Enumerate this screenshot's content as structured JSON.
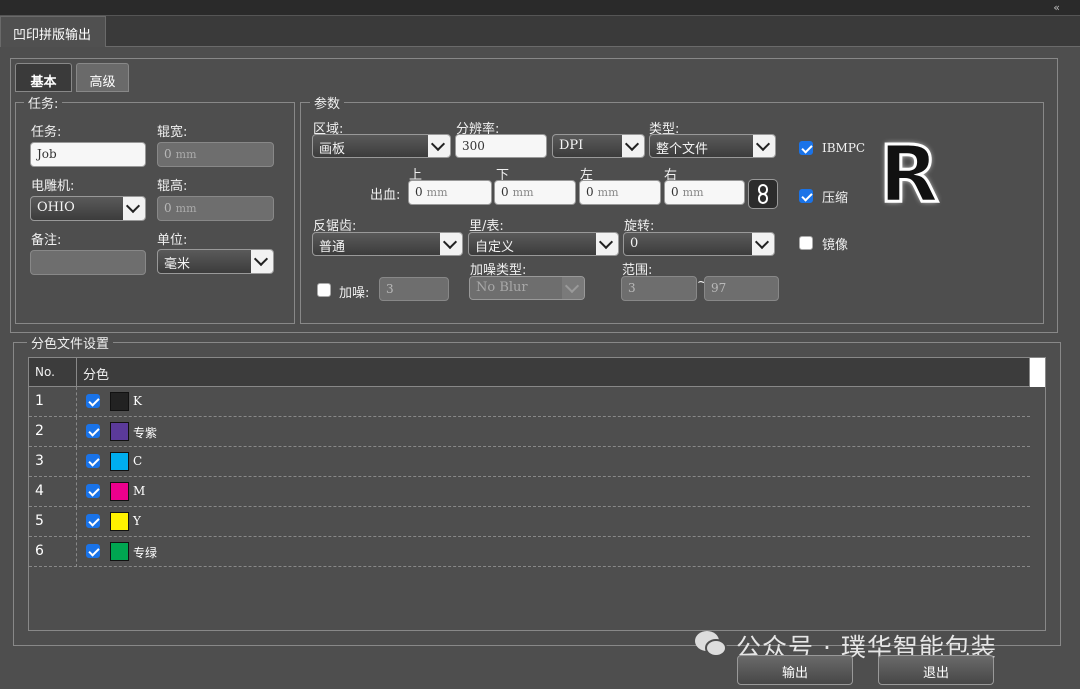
{
  "window": {
    "tab_title": "凹印拼版输出",
    "collapse_glyph": "«"
  },
  "tabs": {
    "basic": "基本",
    "advanced": "高级"
  },
  "task": {
    "group_title": "任务:",
    "task_label": "任务:",
    "task_value": "Job",
    "roll_width_label": "辊宽:",
    "roll_width_value": "0",
    "roll_width_unit": "mm",
    "engraver_label": "电雕机:",
    "engraver_value": "OHIO",
    "roll_height_label": "辊高:",
    "roll_height_value": "0",
    "roll_height_unit": "mm",
    "note_label": "备注:",
    "note_value": "",
    "unit_label": "单位:",
    "unit_value": "毫米"
  },
  "params": {
    "group_title": "参数",
    "region_label": "区域:",
    "region_value": "画板",
    "resolution_label": "分辨率:",
    "resolution_value": "300",
    "resolution_unit": "DPI",
    "type_label": "类型:",
    "type_value": "整个文件",
    "bleed_label": "出血:",
    "bleed_top_label": "上",
    "bleed_top_value": "0",
    "bleed_bottom_label": "下",
    "bleed_bottom_value": "0",
    "bleed_left_label": "左",
    "bleed_left_value": "0",
    "bleed_right_label": "右",
    "bleed_right_value": "0",
    "bleed_unit": "mm",
    "antialias_label": "反锯齿:",
    "antialias_value": "普通",
    "side_label": "里/表:",
    "side_value": "自定义",
    "rotate_label": "旋转:",
    "rotate_value": "0",
    "noise_label": "加噪:",
    "noise_value": "3",
    "noise_checked": false,
    "noise_type_label": "加噪类型:",
    "noise_type_value": "No Blur",
    "range_label": "范围:",
    "range_min": "3",
    "range_sep": "~",
    "range_max": "97",
    "ibmpc_label": "IBMPC",
    "ibmpc_checked": true,
    "compress_label": "压缩",
    "compress_checked": true,
    "mirror_label": "镜像",
    "mirror_checked": false,
    "logo_letter": "R"
  },
  "separations": {
    "group_title": "分色文件设置",
    "col_no": "No.",
    "col_sep": "分色",
    "rows": [
      {
        "no": "1",
        "name": "K",
        "color": "#222222",
        "checked": true
      },
      {
        "no": "2",
        "name": "专紫",
        "color": "#5b3a9a",
        "checked": true
      },
      {
        "no": "3",
        "name": "C",
        "color": "#00aeef",
        "checked": true
      },
      {
        "no": "4",
        "name": "M",
        "color": "#ec008c",
        "checked": true
      },
      {
        "no": "5",
        "name": "Y",
        "color": "#fff200",
        "checked": true
      },
      {
        "no": "6",
        "name": "专绿",
        "color": "#00a651",
        "checked": true
      }
    ]
  },
  "footer": {
    "output_label": "输出",
    "exit_label": "退出",
    "watermark": "公众号 · 璞华智能包装"
  }
}
